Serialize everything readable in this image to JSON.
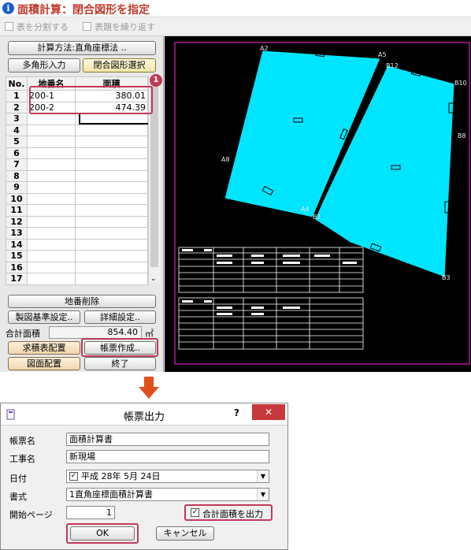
{
  "window": {
    "title": "面積計算：閉合図形を指定",
    "options": {
      "split_table": "表を分割する",
      "repeat_header": "表題を繰り返す"
    }
  },
  "left_panel": {
    "calc_method_button": "計算方法:直角座標法 ..",
    "polygon_input_button": "多角形入力",
    "closed_select_button": "閉合図形選択",
    "columns": [
      "No.",
      "地番名",
      "面積"
    ],
    "rows": [
      {
        "no": "1",
        "name": "200-1",
        "area": "380.01"
      },
      {
        "no": "2",
        "name": "200-2",
        "area": "474.39"
      },
      {
        "no": "3",
        "name": "",
        "area": ""
      },
      {
        "no": "4",
        "name": "",
        "area": ""
      },
      {
        "no": "5",
        "name": "",
        "area": ""
      },
      {
        "no": "6",
        "name": "",
        "area": ""
      },
      {
        "no": "7",
        "name": "",
        "area": ""
      },
      {
        "no": "8",
        "name": "",
        "area": ""
      },
      {
        "no": "9",
        "name": "",
        "area": ""
      },
      {
        "no": "10",
        "name": "",
        "area": ""
      },
      {
        "no": "11",
        "name": "",
        "area": ""
      },
      {
        "no": "12",
        "name": "",
        "area": ""
      },
      {
        "no": "13",
        "name": "",
        "area": ""
      },
      {
        "no": "14",
        "name": "",
        "area": ""
      },
      {
        "no": "15",
        "name": "",
        "area": ""
      },
      {
        "no": "16",
        "name": "",
        "area": ""
      },
      {
        "no": "17",
        "name": "",
        "area": ""
      }
    ],
    "callout_number": "1",
    "delete_lot_button": "地番削除",
    "drawing_settings_button": "製図基準設定..",
    "detail_settings_button": "詳細設定..",
    "total_area_label": "合計面積",
    "total_area_value": "854.40",
    "total_area_unit": "㎡",
    "area_table_button": "求積表配置",
    "form_create_button": "帳票作成..",
    "drawing_place_button": "図面配置",
    "exit_button": "終了"
  },
  "canvas": {
    "points": [
      "A2",
      "A5",
      "B12",
      "B10",
      "B8",
      "B3",
      "A8",
      "A4",
      "B1"
    ],
    "colors": {
      "fill": "#00e5ff",
      "frame": "#b0189a",
      "background": "#000000"
    }
  },
  "dialog": {
    "title": "帳票出力",
    "help": "?",
    "close": "✕",
    "form_name_label": "帳票名",
    "form_name_value": "面積計算書",
    "project_label": "工事名",
    "project_value": "新現場",
    "date_label": "日付",
    "date_value": "平成 28年  5月 24日",
    "format_label": "書式",
    "format_value": "1直角座標面積計算書",
    "start_page_label": "開始ページ",
    "start_page_value": "1",
    "total_output_label": "合計面積を出力",
    "ok_button": "OK",
    "cancel_button": "キャンセル"
  },
  "accent_colors": {
    "highlight": "#c0395a",
    "arrow": "#e0501a"
  }
}
